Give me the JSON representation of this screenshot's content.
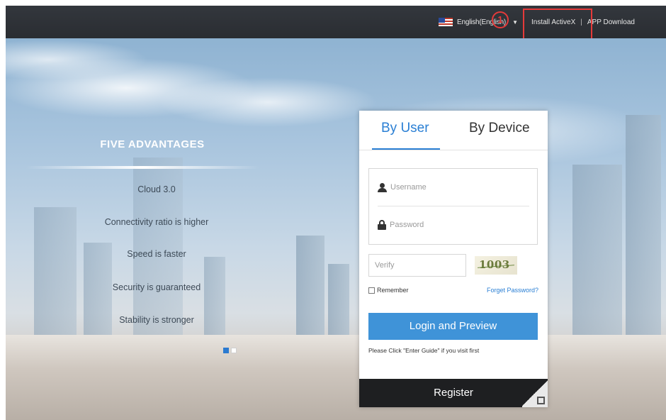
{
  "topbar": {
    "language": "English(English)",
    "annotation_number": "1",
    "install_activex": "Install ActiveX",
    "separator": "|",
    "app_download": "APP Download"
  },
  "advantages": {
    "title": "FIVE ADVANTAGES",
    "items": [
      "Cloud 3.0",
      "Connectivity ratio is higher",
      "Speed is faster",
      "Security is guaranteed",
      "Stability is stronger"
    ]
  },
  "login": {
    "tabs": [
      "By User",
      "By Device"
    ],
    "active_tab": "By User",
    "username_placeholder": "Username",
    "password_placeholder": "Password",
    "verify_placeholder": "Verify",
    "captcha_text": "1003",
    "remember_label": "Remember",
    "forget_password": "Forget Password?",
    "login_button": "Login and Preview",
    "guide_text": "Please Click \"Enter Guide\" if you visit first",
    "register_button": "Register"
  },
  "colors": {
    "accent": "#2a7fd4",
    "button": "#3f93d8",
    "topbar": "#2d3035",
    "highlight": "#e53a3a"
  }
}
